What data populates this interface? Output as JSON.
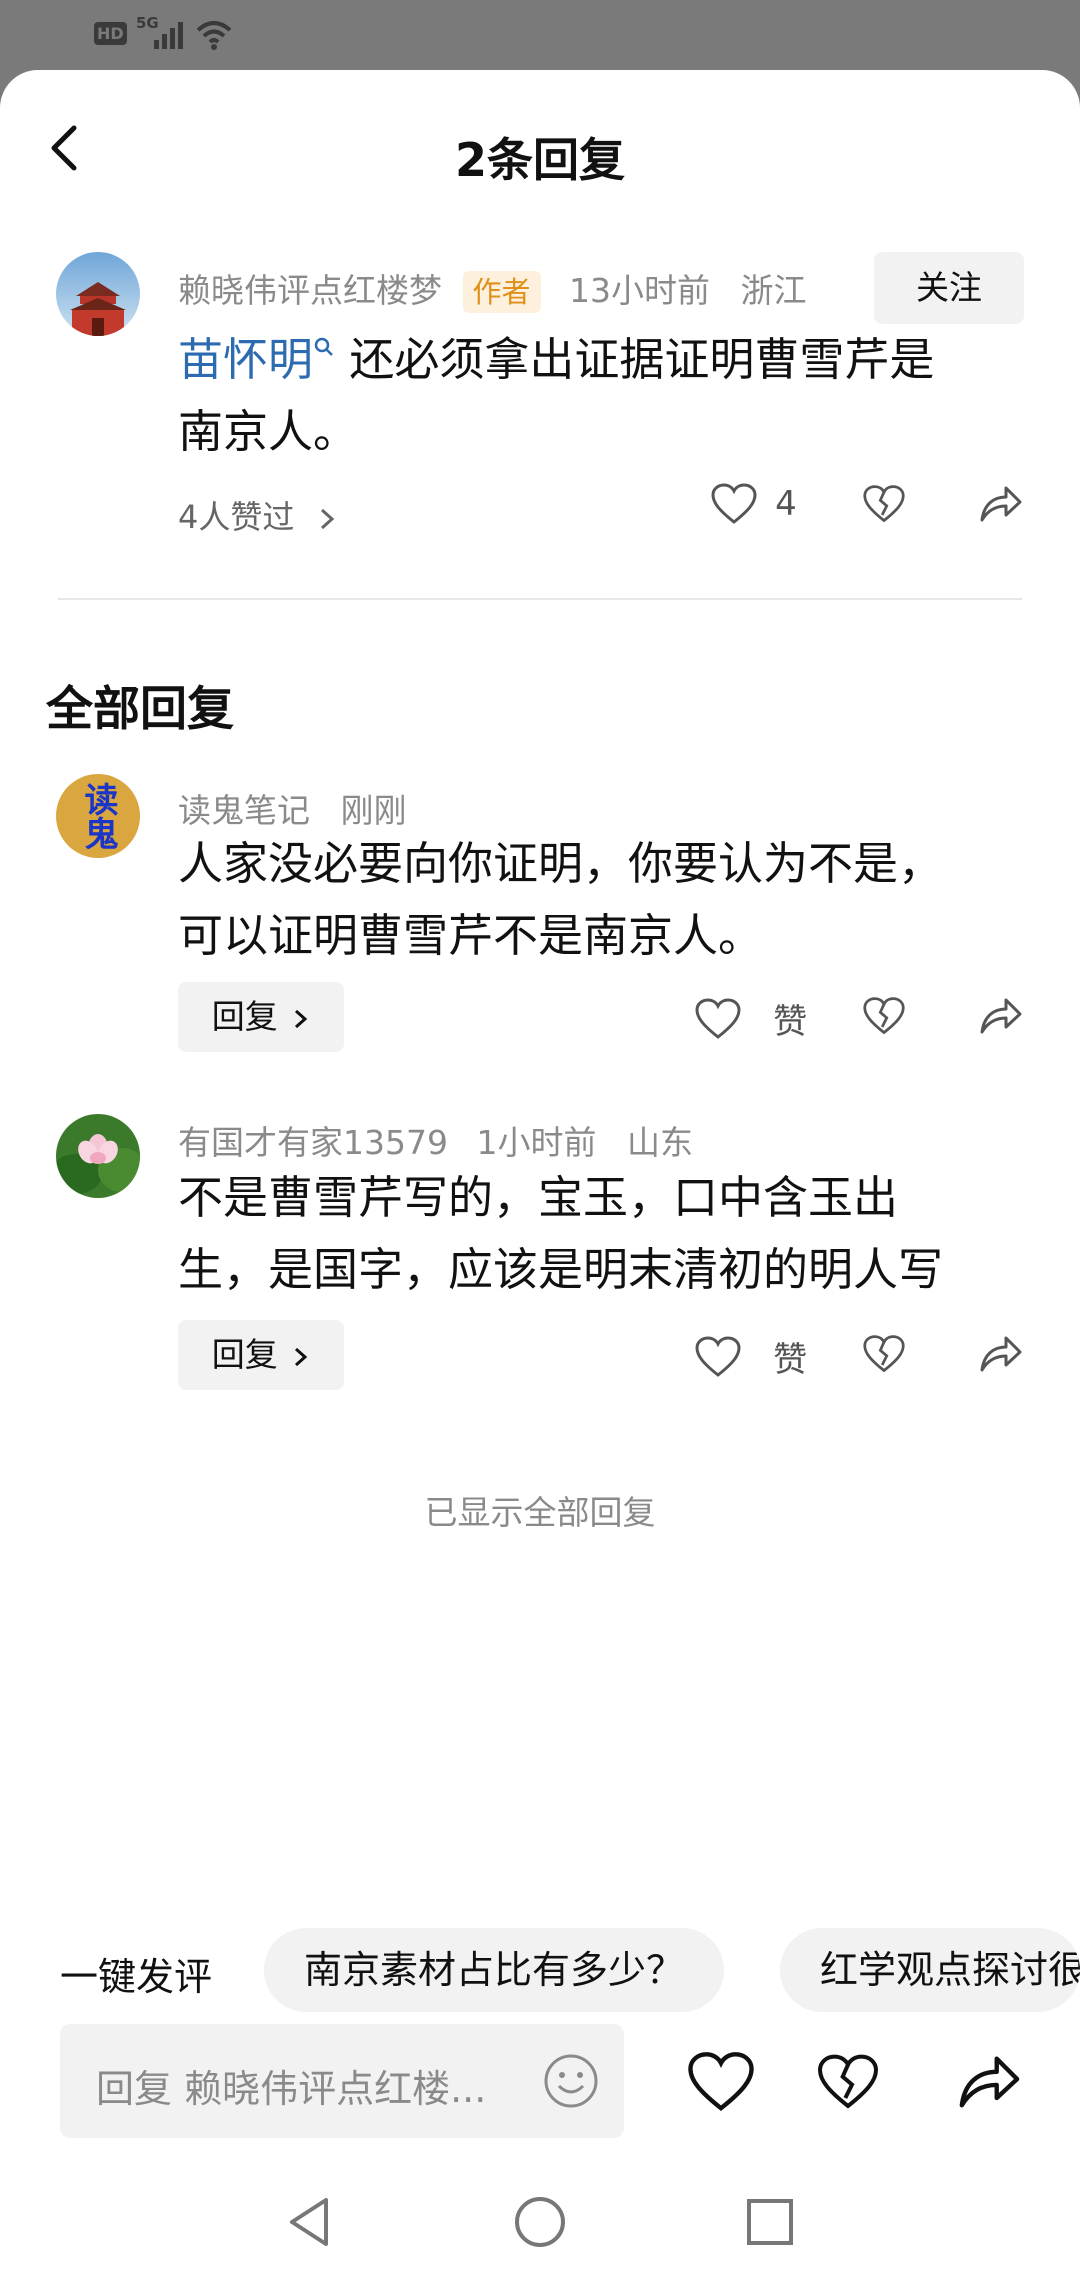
{
  "status": {
    "hd_label": "HD",
    "network_label": "5G"
  },
  "header": {
    "title": "2条回复"
  },
  "main_comment": {
    "author": "赖晓伟评点红楼梦",
    "badge": "作者",
    "time": "13小时前",
    "location": "浙江",
    "follow_label": "关注",
    "mention": "苗怀明",
    "text_after_mention": " 还必须拿出证据证明曹雪芹是",
    "text_line2": "南京人。",
    "likes_summary": "4人赞过",
    "like_count": "4"
  },
  "section": {
    "title": "全部回复"
  },
  "replies": [
    {
      "author": "读鬼笔记",
      "avatar_text": "读鬼",
      "time": "刚刚",
      "location": "",
      "line1": "人家没必要向你证明，你要认为不是，",
      "line2": "可以证明曹雪芹不是南京人。",
      "reply_label": "回复",
      "like_label": "赞"
    },
    {
      "author": "有国才有家13579",
      "time": "1小时前",
      "location": "山东",
      "line1": "不是曹雪芹写的，宝玉，口中含玉出",
      "line2": "生，是国字，应该是明末清初的明人写",
      "reply_label": "回复",
      "like_label": "赞"
    }
  ],
  "end_note": "已显示全部回复",
  "quick_reply": {
    "label": "一键发评",
    "chips": [
      "南京素材占比有多少？",
      "红学观点探讨很"
    ]
  },
  "input": {
    "placeholder": "回复 赖晓伟评点红楼..."
  },
  "icons": {
    "back": "back-arrow-icon",
    "like": "heart-icon",
    "dislike": "broken-heart-icon",
    "share": "share-icon",
    "emoji": "emoji-icon"
  }
}
